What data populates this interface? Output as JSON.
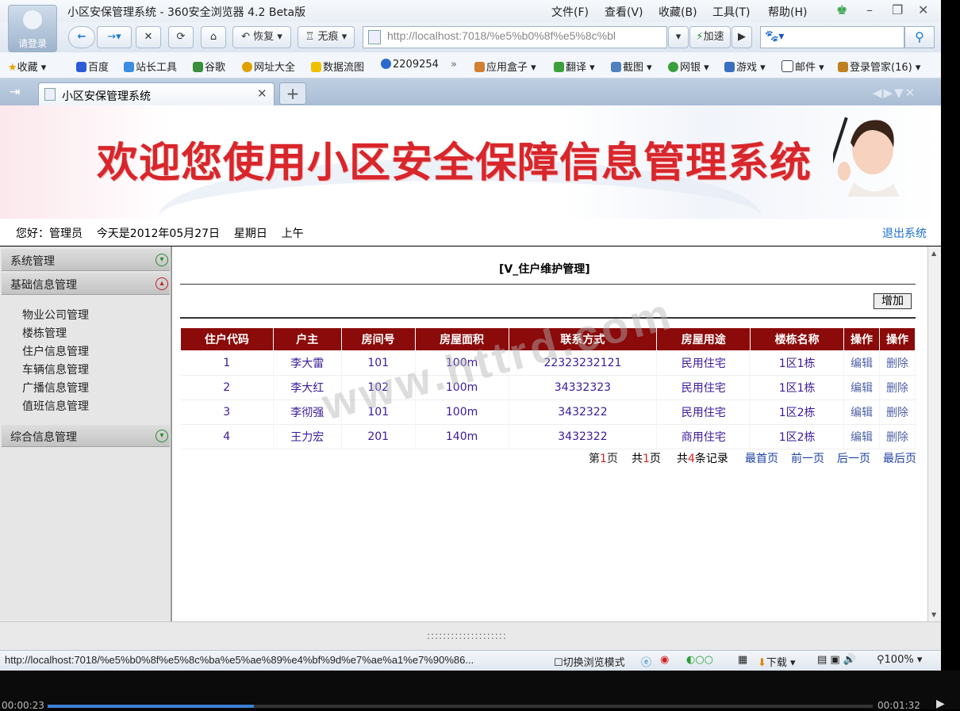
{
  "browser": {
    "window_title": "小区安保管理系统 - 360安全浏览器 4.2 Beta版",
    "login_label": "请登录",
    "menus": [
      "文件(F)",
      "查看(V)",
      "收藏(B)",
      "工具(T)",
      "帮助(H)"
    ],
    "nav": {
      "restore": "恢复",
      "notrace": "无痕",
      "url": "http://localhost:7018/%e5%b0%8f%e5%8c%bl",
      "accelerate": "加速"
    },
    "bookmarks": [
      "收藏",
      "百度",
      "站长工具",
      "谷歌",
      "网址大全",
      "数据流图",
      "2209254",
      "»",
      "应用盒子",
      "翻译",
      "截图",
      "网银",
      "游戏",
      "邮件",
      "登录管家(16)"
    ],
    "tab_title": "小区安保管理系统",
    "status_url": "http://localhost:7018/%e5%b0%8f%e5%8c%ba%e5%ae%89%e4%bf%9d%e7%ae%a1%e7%90%86...",
    "status_items": {
      "mode": "切换浏览模式",
      "download": "下载",
      "zoom": "100%"
    }
  },
  "app": {
    "banner_title": "欢迎您使用小区安全保障信息管理系统",
    "greeting": "您好：管理员    今天是2012年05月27日    星期日    上午",
    "logout": "退出系统",
    "sidebar": {
      "sections": [
        {
          "label": "系统管理"
        },
        {
          "label": "基础信息管理"
        },
        {
          "label": "综合信息管理"
        }
      ],
      "sub_items": [
        "物业公司管理",
        "楼栋管理",
        "住户信息管理",
        "车辆信息管理",
        "广播信息管理",
        "值班信息管理"
      ]
    },
    "page_title": "[V_住户维护管理]",
    "add_button": "增加",
    "table": {
      "headers": [
        "住户代码",
        "户主",
        "房间号",
        "房屋面积",
        "联系方式",
        "房屋用途",
        "楼栋名称",
        "操作",
        "操作"
      ],
      "rows": [
        [
          "1",
          "李大雷",
          "101",
          "100m",
          "22323232121",
          "民用住宅",
          "1区1栋",
          "编辑",
          "删除"
        ],
        [
          "2",
          "李大红",
          "102",
          "100m",
          "34332323",
          "民用住宅",
          "1区1栋",
          "编辑",
          "删除"
        ],
        [
          "3",
          "李彻强",
          "101",
          "100m",
          "3432322",
          "民用住宅",
          "1区2栋",
          "编辑",
          "删除"
        ],
        [
          "4",
          "王力宏",
          "201",
          "140m",
          "3432322",
          "商用住宅",
          "1区2栋",
          "编辑",
          "删除"
        ]
      ]
    },
    "pager": {
      "page_prefix": "第",
      "page_num": "1",
      "page_suffix": "页",
      "total_prefix": "共",
      "total_pages": "1",
      "total_suffix": "页",
      "rec_prefix": "共",
      "records": "4",
      "rec_suffix": "条记录",
      "first": "最首页",
      "prev": "前一页",
      "next": "后一页",
      "last": "最后页"
    },
    "watermark": "www.httrd.com"
  },
  "player": {
    "elapsed": "00:00:23",
    "total": "00:01:32",
    "progress": 0.25
  },
  "colors": {
    "table_header": "#8b0a0a",
    "banner_title": "#d8262b",
    "link": "#1a6fd0"
  }
}
